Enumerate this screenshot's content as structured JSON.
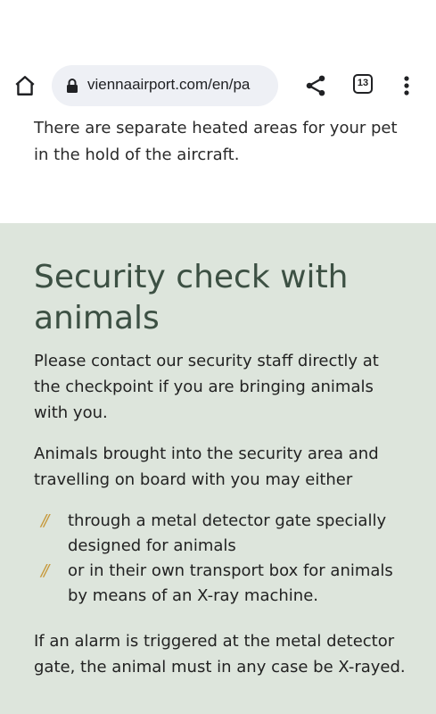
{
  "browser": {
    "url": "viennaairport.com/en/pa",
    "tab_count": "13"
  },
  "page": {
    "intro_text": "There are separate heated areas for your pet in the hold of the aircraft.",
    "section": {
      "title": "Security check with animals",
      "para1": "Please contact our security staff directly at the checkpoint if you are bringing animals with you.",
      "para2": "Animals brought into the security area and travelling on board with you may either",
      "list": [
        {
          "bullet": "//",
          "text": "through a metal detector gate specially designed for animals"
        },
        {
          "bullet": "//",
          "text": "or in their own transport box for animals by means of an X-ray machine."
        }
      ],
      "para3": "If an alarm is triggered at the metal detector gate, the animal must in any case be X-rayed."
    }
  },
  "colors": {
    "section_bg": "#dde5dc",
    "title": "#3c5043",
    "bullet": "#c79a3e"
  }
}
